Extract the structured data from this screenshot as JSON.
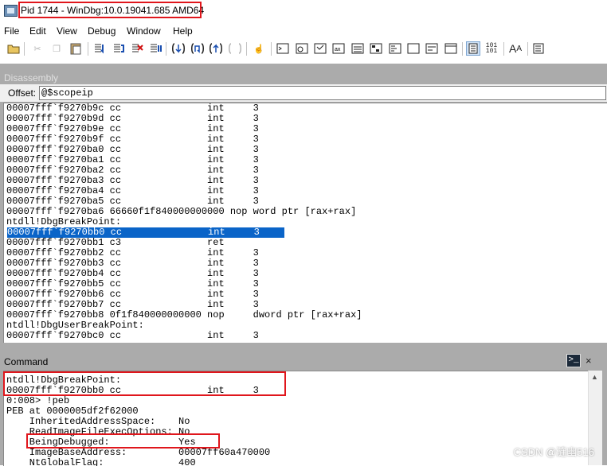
{
  "window": {
    "title": "Pid 1744 - WinDbg:10.0.19041.685 AMD64"
  },
  "menu": [
    "File",
    "Edit",
    "View",
    "Debug",
    "Window",
    "Help"
  ],
  "toolbar": {
    "icons": [
      "open-icon",
      "cut-icon",
      "copy-icon",
      "paste-icon",
      "go-icon",
      "restart-icon",
      "stop-debugging-icon",
      "break-icon",
      "step-into-icon",
      "step-over-icon",
      "step-out-icon",
      "run-to-cursor-icon",
      "hand-icon",
      "command-window-icon",
      "watch-icon",
      "locals-icon",
      "registers-icon",
      "memory-icon",
      "call-stack-icon",
      "disassembly-icon",
      "scratch-pad-icon",
      "source-mode-icon",
      "hex-mode-icon",
      "font-icon",
      "options-icon"
    ],
    "hex_label": "101\n101",
    "font_label": "A",
    "font_label_small": "A"
  },
  "disassembly": {
    "title": "Disassembly",
    "offset_label": "Offset:",
    "offset_value": "@$scopeip",
    "lines": [
      "00007fff`f9270b9c cc               int     3",
      "00007fff`f9270b9d cc               int     3",
      "00007fff`f9270b9e cc               int     3",
      "00007fff`f9270b9f cc               int     3",
      "00007fff`f9270ba0 cc               int     3",
      "00007fff`f9270ba1 cc               int     3",
      "00007fff`f9270ba2 cc               int     3",
      "00007fff`f9270ba3 cc               int     3",
      "00007fff`f9270ba4 cc               int     3",
      "00007fff`f9270ba5 cc               int     3",
      "00007fff`f9270ba6 66660f1f840000000000 nop word ptr [rax+rax]",
      "ntdll!DbgBreakPoint:",
      "00007fff`f9270bb0 cc               int     3",
      "00007fff`f9270bb1 c3               ret",
      "00007fff`f9270bb2 cc               int     3",
      "00007fff`f9270bb3 cc               int     3",
      "00007fff`f9270bb4 cc               int     3",
      "00007fff`f9270bb5 cc               int     3",
      "00007fff`f9270bb6 cc               int     3",
      "00007fff`f9270bb7 cc               int     3",
      "00007fff`f9270bb8 0f1f840000000000 nop     dword ptr [rax+rax]",
      "ntdll!DbgUserBreakPoint:",
      "00007fff`f9270bc0 cc               int     3"
    ],
    "selected_index": 12
  },
  "command": {
    "title": "Command",
    "icon_glyph": ">_",
    "close_glyph": "×",
    "lines": [
      "ntdll!DbgBreakPoint:",
      "00007fff`f9270bb0 cc               int     3",
      "0:008> !peb",
      "PEB at 0000005df2f62000",
      "    InheritedAddressSpace:    No",
      "    ReadImageFileExecOptions: No",
      "    BeingDebugged:            Yes",
      "    ImageBaseAddress:         00007ff60a470000",
      "    NtGlobalFlag:             400"
    ]
  },
  "watermark": "CSDN @涟幽516"
}
